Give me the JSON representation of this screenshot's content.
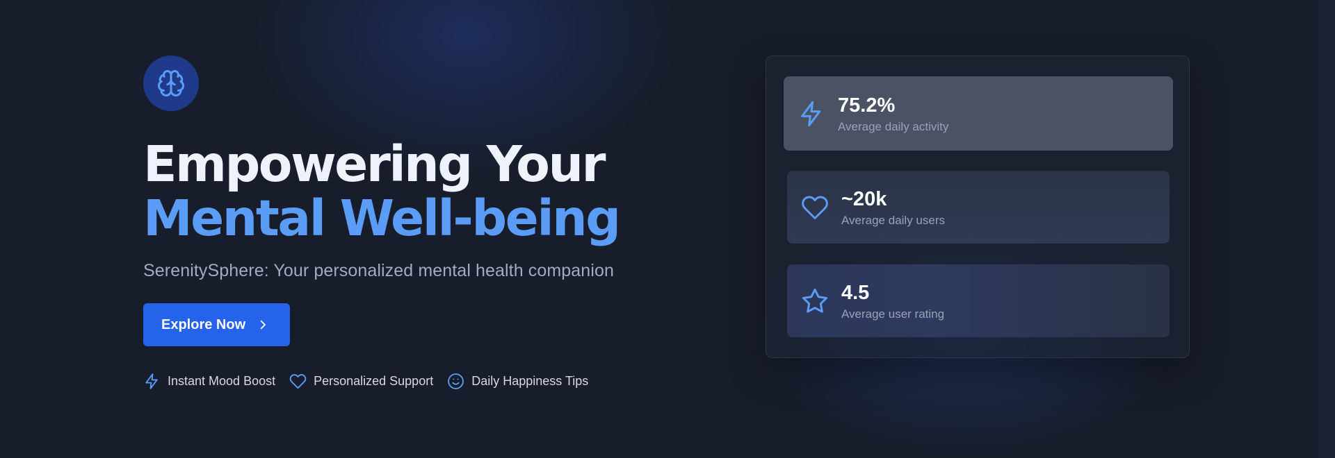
{
  "hero": {
    "headline_line1": "Empowering Your",
    "headline_line2": "Mental Well-being",
    "subtitle": "SerenitySphere: Your personalized mental health companion",
    "cta_label": "Explore Now",
    "logo_icon": "brain-icon",
    "features": [
      {
        "icon": "zap-icon",
        "label": "Instant Mood Boost"
      },
      {
        "icon": "heart-icon",
        "label": "Personalized Support"
      },
      {
        "icon": "smile-icon",
        "label": "Daily Happiness Tips"
      }
    ]
  },
  "stats": [
    {
      "icon": "zap-icon",
      "value": "75.2%",
      "label": "Average daily activity"
    },
    {
      "icon": "heart-icon",
      "value": "~20k",
      "label": "Average daily users"
    },
    {
      "icon": "star-icon",
      "value": "4.5",
      "label": "Average user rating"
    }
  ],
  "colors": {
    "background": "#171d2a",
    "accent": "#5b9cf6",
    "button": "#2563eb",
    "logo_badge": "#1f3a8a",
    "heading": "#eef2fb",
    "muted_text": "#a3abbd"
  }
}
